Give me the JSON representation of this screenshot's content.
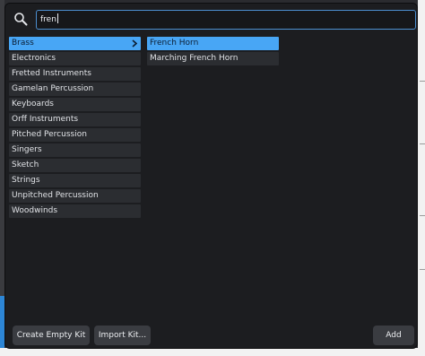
{
  "search": {
    "value": "fren"
  },
  "categories": [
    {
      "label": "Brass",
      "selected": true
    },
    {
      "label": "Electronics"
    },
    {
      "label": "Fretted Instruments"
    },
    {
      "label": "Gamelan Percussion"
    },
    {
      "label": "Keyboards"
    },
    {
      "label": "Orff Instruments"
    },
    {
      "label": "Pitched Percussion"
    },
    {
      "label": "Singers"
    },
    {
      "label": "Sketch"
    },
    {
      "label": "Strings"
    },
    {
      "label": "Unpitched Percussion"
    },
    {
      "label": "Woodwinds"
    }
  ],
  "instruments": [
    {
      "label": "French Horn",
      "selected": true
    },
    {
      "label": "Marching French Horn"
    }
  ],
  "footer": {
    "create_label": "Create Empty Kit",
    "import_label": "Import Kit...",
    "add_label": "Add"
  },
  "colors": {
    "selection": "#48a6f5",
    "item_bg": "#2b2d31",
    "dialog_bg": "#1c1d20",
    "focus_border": "#4c8fd0"
  },
  "icons": {
    "search": "search-icon",
    "chevron": "chevron-right-icon"
  }
}
